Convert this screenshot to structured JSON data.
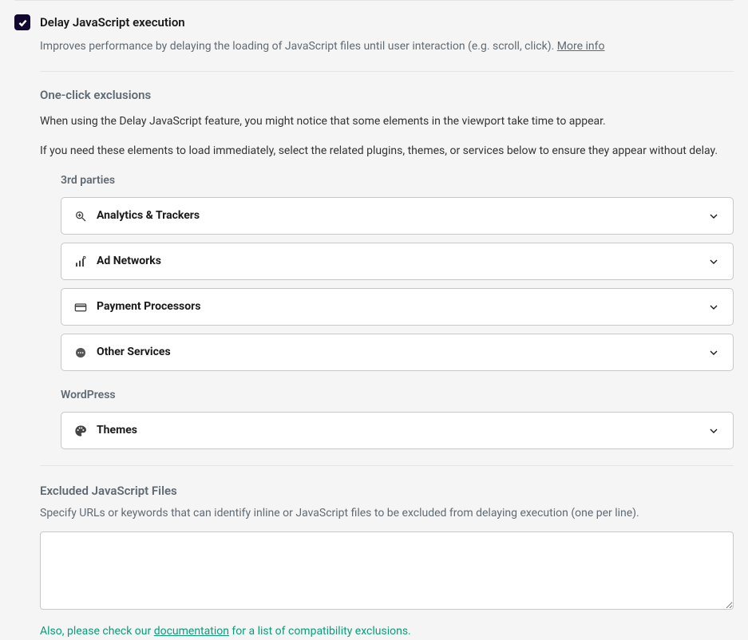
{
  "checkbox": {
    "label": "Delay JavaScript execution",
    "description": "Improves performance by delaying the loading of JavaScript files until user interaction (e.g. scroll, click). ",
    "more_info": "More info"
  },
  "exclusions": {
    "title": "One-click exclusions",
    "desc1": "When using the Delay JavaScript feature, you might notice that some elements in the viewport take time to appear.",
    "desc2": "If you need these elements to load immediately, select the related plugins, themes, or services below to ensure they appear without delay."
  },
  "groups": {
    "third_parties": {
      "label": "3rd parties",
      "items": [
        {
          "label": "Analytics & Trackers"
        },
        {
          "label": "Ad Networks"
        },
        {
          "label": "Payment Processors"
        },
        {
          "label": "Other Services"
        }
      ]
    },
    "wordpress": {
      "label": "WordPress",
      "items": [
        {
          "label": "Themes"
        }
      ]
    }
  },
  "excluded": {
    "title": "Excluded JavaScript Files",
    "desc": "Specify URLs or keywords that can identify inline or JavaScript files to be excluded from delaying execution (one per line).",
    "value": ""
  },
  "doc_note": {
    "prefix": "Also, please check our ",
    "link": "documentation",
    "suffix": " for a list of compatibility exclusions."
  }
}
